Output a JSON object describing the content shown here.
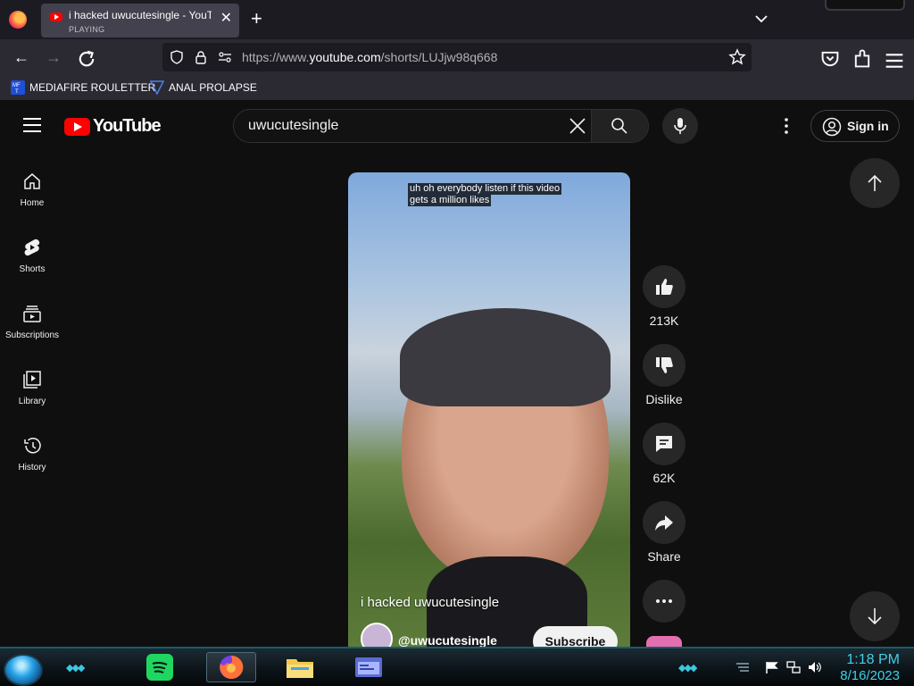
{
  "browser": {
    "tab": {
      "title": "i hacked uwucutesingle - YouTube",
      "status": "PLAYING"
    },
    "url": {
      "prefix": "https://www.",
      "domain": "youtube.com",
      "path": "/shorts/LUJjw98q668"
    },
    "bookmarks": [
      {
        "label": "MEDIAFIRE ROULETTER",
        "icon": "mediafire-icon"
      },
      {
        "label": "ANAL PROLAPSE",
        "icon": "bookmark-icon"
      }
    ]
  },
  "youtube": {
    "logo_text": "YouTube",
    "search": {
      "value": "uwucutesingle"
    },
    "signin_label": "Sign in",
    "guide": [
      {
        "label": "Home",
        "icon": "home-icon"
      },
      {
        "label": "Shorts",
        "icon": "shorts-icon"
      },
      {
        "label": "Subscriptions",
        "icon": "subscriptions-icon"
      },
      {
        "label": "Library",
        "icon": "library-icon"
      },
      {
        "label": "History",
        "icon": "history-icon"
      }
    ],
    "short": {
      "caption_line1": "uh oh everybody listen if this video",
      "caption_line2": "gets a million likes",
      "title": "i hacked uwucutesingle",
      "channel": "@uwucutesingle",
      "subscribe_label": "Subscribe"
    },
    "actions": {
      "likes": "213K",
      "dislike_label": "Dislike",
      "comments": "62K",
      "share_label": "Share"
    }
  },
  "taskbar": {
    "time": "1:18 PM",
    "date": "8/16/2023",
    "apps": [
      "spotify-icon",
      "firefox-icon",
      "file-explorer-icon",
      "window-app-icon"
    ]
  },
  "colors": {
    "youtube_red": "#ff0000",
    "background": "#0f0f0f",
    "clock": "#3fd0e8"
  }
}
